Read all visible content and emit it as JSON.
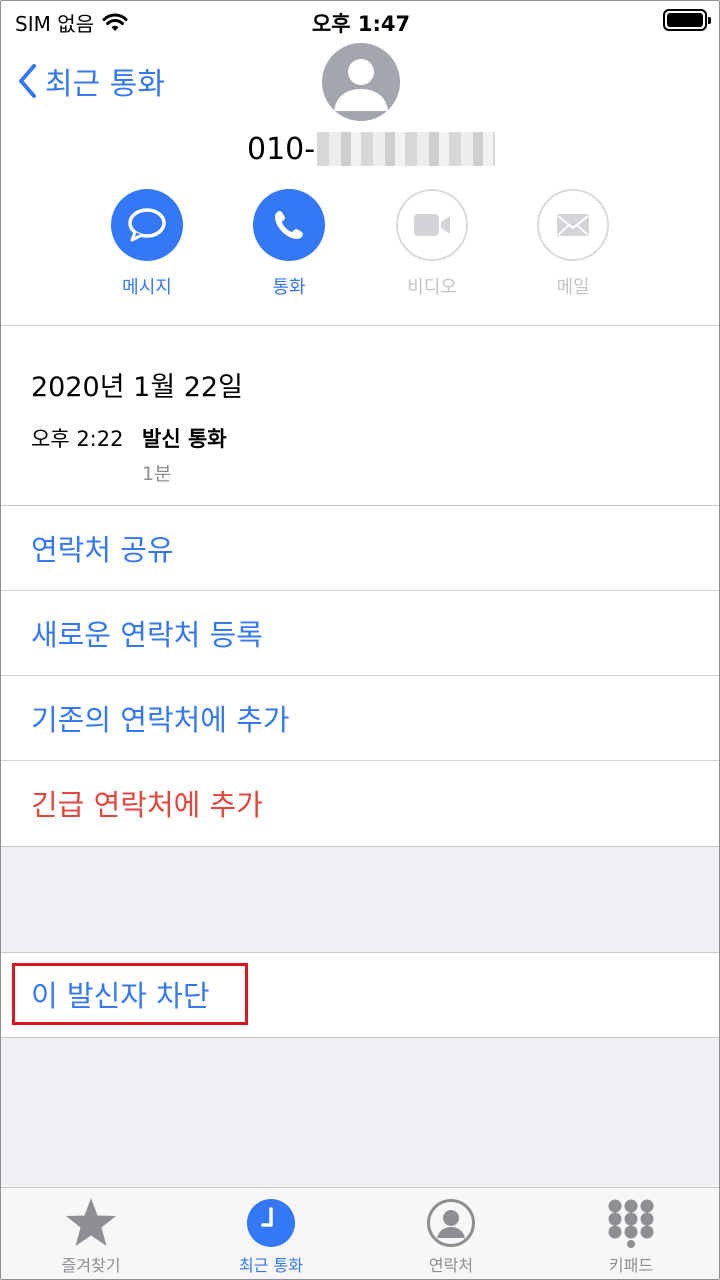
{
  "status_bar": {
    "carrier": "SIM 없음",
    "time": "오후 1:47"
  },
  "header": {
    "back_label": "최근 통화",
    "phone_number_prefix": "010-"
  },
  "actions": [
    {
      "label": "메시지",
      "icon": "message-bubble-icon",
      "enabled": true
    },
    {
      "label": "통화",
      "icon": "phone-icon",
      "enabled": true
    },
    {
      "label": "비디오",
      "icon": "video-camera-icon",
      "enabled": false
    },
    {
      "label": "메일",
      "icon": "mail-envelope-icon",
      "enabled": false
    }
  ],
  "call_log": {
    "date": "2020년 1월 22일",
    "time": "오후 2:22",
    "type": "발신 통화",
    "duration": "1분"
  },
  "menu": {
    "share_contact": "연락처 공유",
    "create_contact": "새로운 연락처 등록",
    "add_existing": "기존의 연락처에 추가",
    "add_emergency": "긴급 연락처에 추가"
  },
  "block_label": "이 발신자 차단",
  "tabs": [
    {
      "label": "즐겨찾기",
      "icon": "star-icon",
      "active": false
    },
    {
      "label": "최근 통화",
      "icon": "clock-icon",
      "active": true
    },
    {
      "label": "연락처",
      "icon": "person-circle-icon",
      "active": false
    },
    {
      "label": "키패드",
      "icon": "keypad-icon",
      "active": false
    }
  ],
  "colors": {
    "accent": "#3478f6",
    "danger": "#e5453a",
    "highlight_box": "#e0141e",
    "disabled": "#c4c4c8",
    "grouped_background": "#efeff4"
  }
}
